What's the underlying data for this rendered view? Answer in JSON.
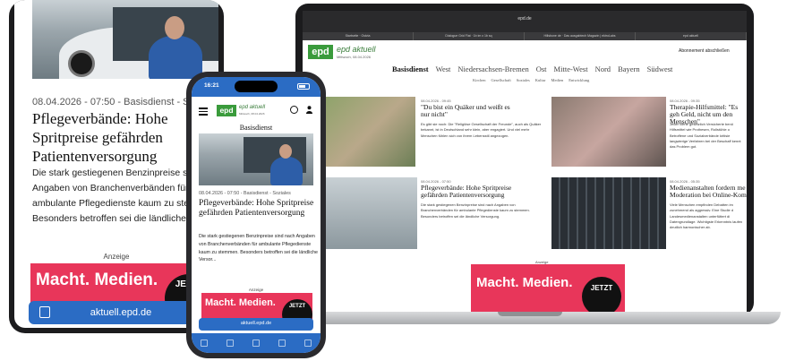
{
  "tablet": {
    "meta": "08.04.2026 - 07:50 - Basisdienst - Soziales",
    "title": "Pflegeverbände: Hohe Spritpreise gefährden Patientenversorgung",
    "teaser": "Die stark gestiegenen Benzinpreise sind n Angaben von Branchenverbänden für ambulante Pflegedienste kaum zu stemm Besonders betroffen sei die ländliche Ver",
    "ad_label": "Anzeige",
    "ad_text": "Macht. Medien.",
    "ad_badge": "JETZT",
    "url": "aktuell.epd.de"
  },
  "laptop": {
    "url": "epd.de",
    "tabs": [
      "Startseite · Ostvia",
      "Dialogue Grid Flat · 1b im x 1b sq",
      "Hillsbone de · Das ausgabtech Magazin | ektroLabs",
      "epd aktuell"
    ],
    "logo": "epd",
    "site_name": "epd aktuell",
    "site_date": "Mittwoch, 08.04.2026",
    "abo": "Abonnement abschließen",
    "nav": [
      "Basisdienst",
      "West",
      "Niedersachsen-Bremen",
      "Ost",
      "Mitte-West",
      "Nord",
      "Bayern",
      "Südwest"
    ],
    "subnav": [
      "Kirchen",
      "Gesellschaft",
      "Soziales",
      "Kultur",
      "Medien",
      "Entwicklung"
    ],
    "articles": [
      {
        "meta": "08.04.2026 - 09:45",
        "title": "\"Du bist ein Quäker und weißt es nur nicht\"",
        "teaser": "Es gibt sie noch: Die \"Religiöse Gesellschaft der Freunde\", auch als Quäker bekannt, ist in Deutschland sehr klein, aber engagiert. Und viel mehr Menschen fühlen sich von ihrem Lebensstil angezogen."
      },
      {
        "meta": "08.04.2026 - 09:35",
        "title": "Therapie-Hilfsmittel: \"Es geh Geld, nicht um den Menschen\"",
        "teaser": "Jeder vierte gesetzlich Versicherte benö Hilfsmittel wie Prothesen, Rollstühle o Betroffene und Sozialverbände kritisie langwierige Verfahren bei der Beschaff kennt das Problem gut."
      },
      {
        "meta": "08.04.2026 - 07:50",
        "title": "Pflegeverbände: Hohe Spritpreise gefährden Patientenversorgung",
        "teaser": "Die stark gestiegenen Benzinpreise sind nach Angaben von Branchenverbänden für ambulante Pflegedienste kaum zu stemmen. Besonders betroffen sei die ländliche Versorgung."
      },
      {
        "meta": "08.04.2026 - 05:35",
        "title": "Medienanstalten fordern me Moderation bei Online-Kom",
        "teaser": "Viele Menschen empfinden Debatten im zunehmend als aggressiv. Eine Studie d Landesmedienanstalten unterfüttert di Datengrundlage. Wichtigste Erkenntnis laufen deutlich harmonischer ab."
      }
    ],
    "ad_label": "Anzeige",
    "ad_text": "Macht. Medien.",
    "ad_badge": "JETZT"
  },
  "phone": {
    "time": "16:21",
    "logo": "epd",
    "site_name": "epd aktuell",
    "site_date": "Mittwoch, 08.04.2026",
    "section": "Basisdienst",
    "meta": "08.04.2026 - 07:50 - Basisdienst - Soziales",
    "title": "Pflegeverbände: Hohe Spritpreise gefährden Patientenversorgung",
    "teaser": "Die stark gestiegenen Benzinpreise sind nach Angaben von Branchenverbänden für ambulante Pflegedienste kaum zu stemmen. Besonders betroffen sei die ländliche Versor...",
    "ad_label": "Anzeige",
    "ad_text": "Macht. Medien.",
    "ad_badge": "JETZT",
    "url": "aktuell.epd.de"
  },
  "colors": {
    "brand_green": "#3a9b3c",
    "accent_blue": "#2b6cc4",
    "ad_pink": "#e8365a"
  }
}
